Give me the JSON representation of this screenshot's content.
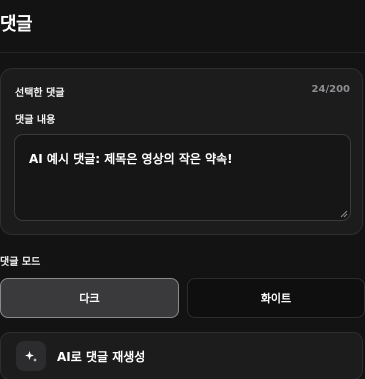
{
  "header": {
    "title": "댓글"
  },
  "comment_card": {
    "label": "선택한 댓글",
    "char_count": "24/200",
    "field_label": "댓글 내용",
    "content": "AI 예시 댓글: 제목은 영상의 작은 약속!"
  },
  "mode": {
    "label": "댓글 모드",
    "options": [
      {
        "label": "다크",
        "selected": true
      },
      {
        "label": "화이트",
        "selected": false
      }
    ]
  },
  "regenerate": {
    "label": "AI로 댓글 재생성",
    "icon": "sparkle-icon"
  }
}
